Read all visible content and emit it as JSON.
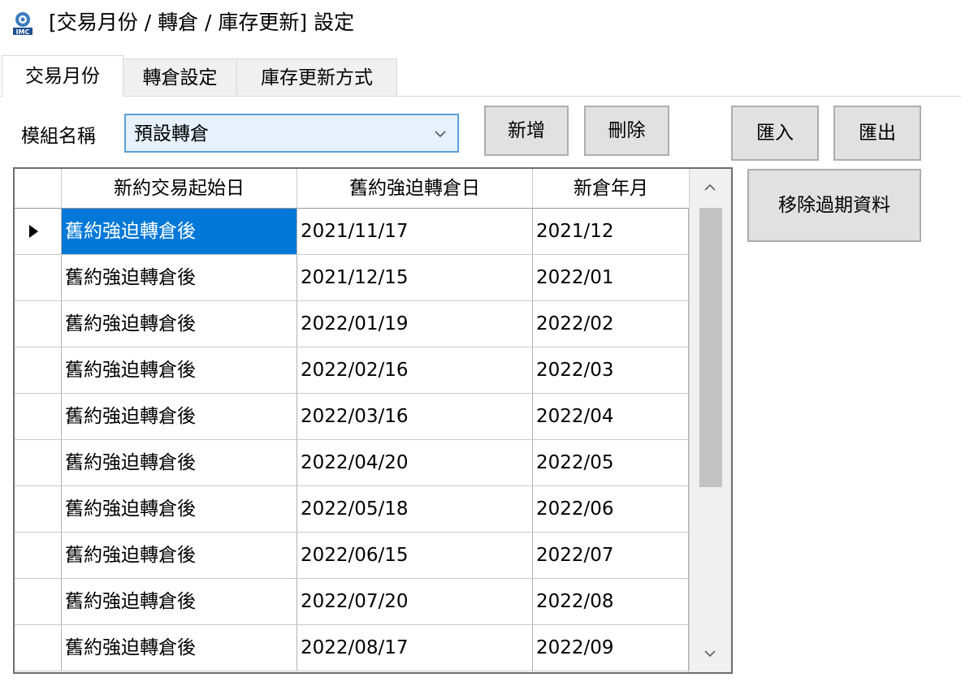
{
  "window": {
    "title": "[交易月份 / 轉倉 / 庫存更新] 設定",
    "icon": "imc-logo-icon"
  },
  "tabs": [
    {
      "label": "交易月份",
      "active": true
    },
    {
      "label": "轉倉設定",
      "active": false
    },
    {
      "label": "庫存更新方式",
      "active": false
    }
  ],
  "module": {
    "label": "模組名稱",
    "selected": "預設轉倉"
  },
  "buttons": {
    "add": "新增",
    "delete": "刪除",
    "import": "匯入",
    "export": "匯出",
    "remove_expired": "移除過期資料"
  },
  "grid": {
    "columns": [
      "新約交易起始日",
      "舊約強迫轉倉日",
      "新倉年月"
    ],
    "rows": [
      [
        "舊約強迫轉倉後",
        "2021/11/17",
        "2021/12"
      ],
      [
        "舊約強迫轉倉後",
        "2021/12/15",
        "2022/01"
      ],
      [
        "舊約強迫轉倉後",
        "2022/01/19",
        "2022/02"
      ],
      [
        "舊約強迫轉倉後",
        "2022/02/16",
        "2022/03"
      ],
      [
        "舊約強迫轉倉後",
        "2022/03/16",
        "2022/04"
      ],
      [
        "舊約強迫轉倉後",
        "2022/04/20",
        "2022/05"
      ],
      [
        "舊約強迫轉倉後",
        "2022/05/18",
        "2022/06"
      ],
      [
        "舊約強迫轉倉後",
        "2022/06/15",
        "2022/07"
      ],
      [
        "舊約強迫轉倉後",
        "2022/07/20",
        "2022/08"
      ],
      [
        "舊約強迫轉倉後",
        "2022/08/17",
        "2022/09"
      ]
    ],
    "selected_row": 0,
    "selection_color": "#0078d7"
  },
  "colors": {
    "combo_bg": "#e6f1fb",
    "combo_border": "#5a9fd9",
    "button_bg": "#e1e1e1"
  }
}
